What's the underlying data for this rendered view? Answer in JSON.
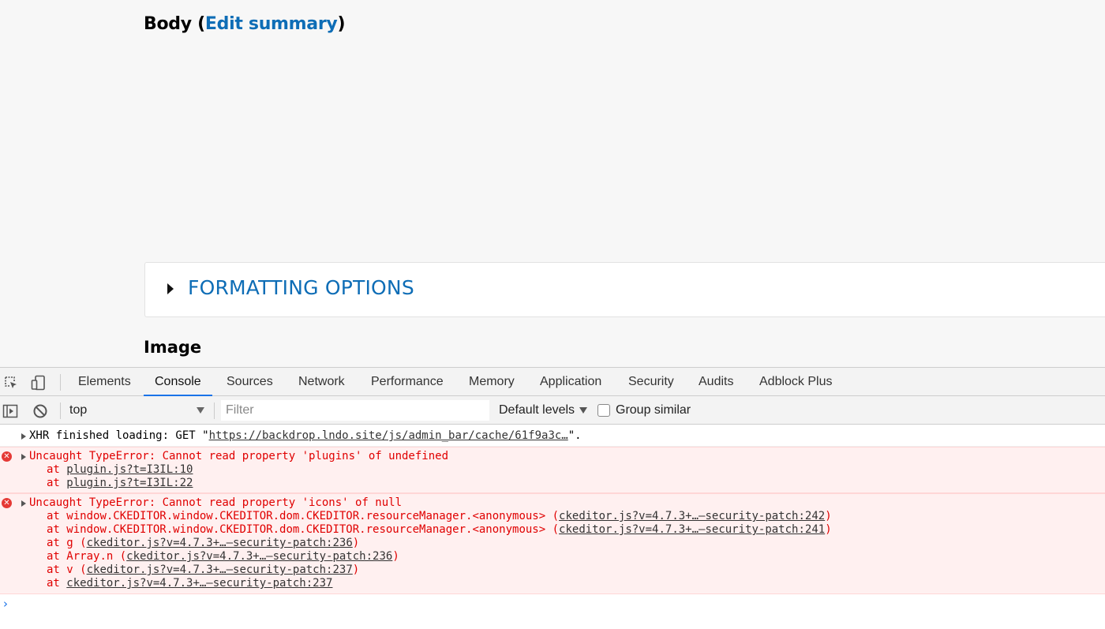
{
  "page": {
    "body_label": "Body",
    "open_paren": "(",
    "edit_summary_link": "Edit summary",
    "close_paren": ")",
    "formatting_options": "FORMATTING OPTIONS",
    "image_label": "Image"
  },
  "devtools": {
    "tabs": [
      "Elements",
      "Console",
      "Sources",
      "Network",
      "Performance",
      "Memory",
      "Application",
      "Security",
      "Audits",
      "Adblock Plus"
    ],
    "active_tab": "Console",
    "toolbar": {
      "context": "top",
      "filter_placeholder": "Filter",
      "levels": "Default levels",
      "group_similar": "Group similar"
    },
    "console": {
      "xhr": {
        "prefix": "XHR finished loading: GET \"",
        "url": "https://backdrop.lndo.site/js/admin_bar/cache/61f9a3c…",
        "suffix": "\"."
      },
      "error1": {
        "message": "Uncaught TypeError: Cannot read property 'plugins' of undefined",
        "stack": [
          {
            "prefix": "at ",
            "fn": "",
            "link": "plugin.js?t=I3IL:10"
          },
          {
            "prefix": "at ",
            "fn": "",
            "link": "plugin.js?t=I3IL:22"
          }
        ]
      },
      "error2": {
        "message": "Uncaught TypeError: Cannot read property 'icons' of null",
        "stack": [
          {
            "prefix": "at ",
            "fn": "window.CKEDITOR.window.CKEDITOR.dom.CKEDITOR.resourceManager.<anonymous> (",
            "link": "ckeditor.js?v=4.7.3+…–security-patch:242",
            "end": ")"
          },
          {
            "prefix": "at ",
            "fn": "window.CKEDITOR.window.CKEDITOR.dom.CKEDITOR.resourceManager.<anonymous> (",
            "link": "ckeditor.js?v=4.7.3+…–security-patch:241",
            "end": ")"
          },
          {
            "prefix": "at ",
            "fn": "g (",
            "link": "ckeditor.js?v=4.7.3+…–security-patch:236",
            "end": ")"
          },
          {
            "prefix": "at ",
            "fn": "Array.n (",
            "link": "ckeditor.js?v=4.7.3+…–security-patch:236",
            "end": ")"
          },
          {
            "prefix": "at ",
            "fn": "v (",
            "link": "ckeditor.js?v=4.7.3+…–security-patch:237",
            "end": ")"
          },
          {
            "prefix": "at ",
            "fn": "",
            "link": "ckeditor.js?v=4.7.3+…–security-patch:237",
            "end": ""
          }
        ]
      },
      "prompt_symbol": "›"
    }
  },
  "colors": {
    "link_blue": "#0e6db6",
    "error_red": "#e00000",
    "error_bg": "#fff0f0",
    "active_tab_underline": "#1a73e8"
  },
  "icons": [
    "inspect-element-icon",
    "device-toolbar-icon",
    "show-sidebar-icon",
    "clear-console-icon",
    "dropdown-arrow-icon",
    "error-icon",
    "expand-triangle-icon",
    "prompt-icon"
  ]
}
